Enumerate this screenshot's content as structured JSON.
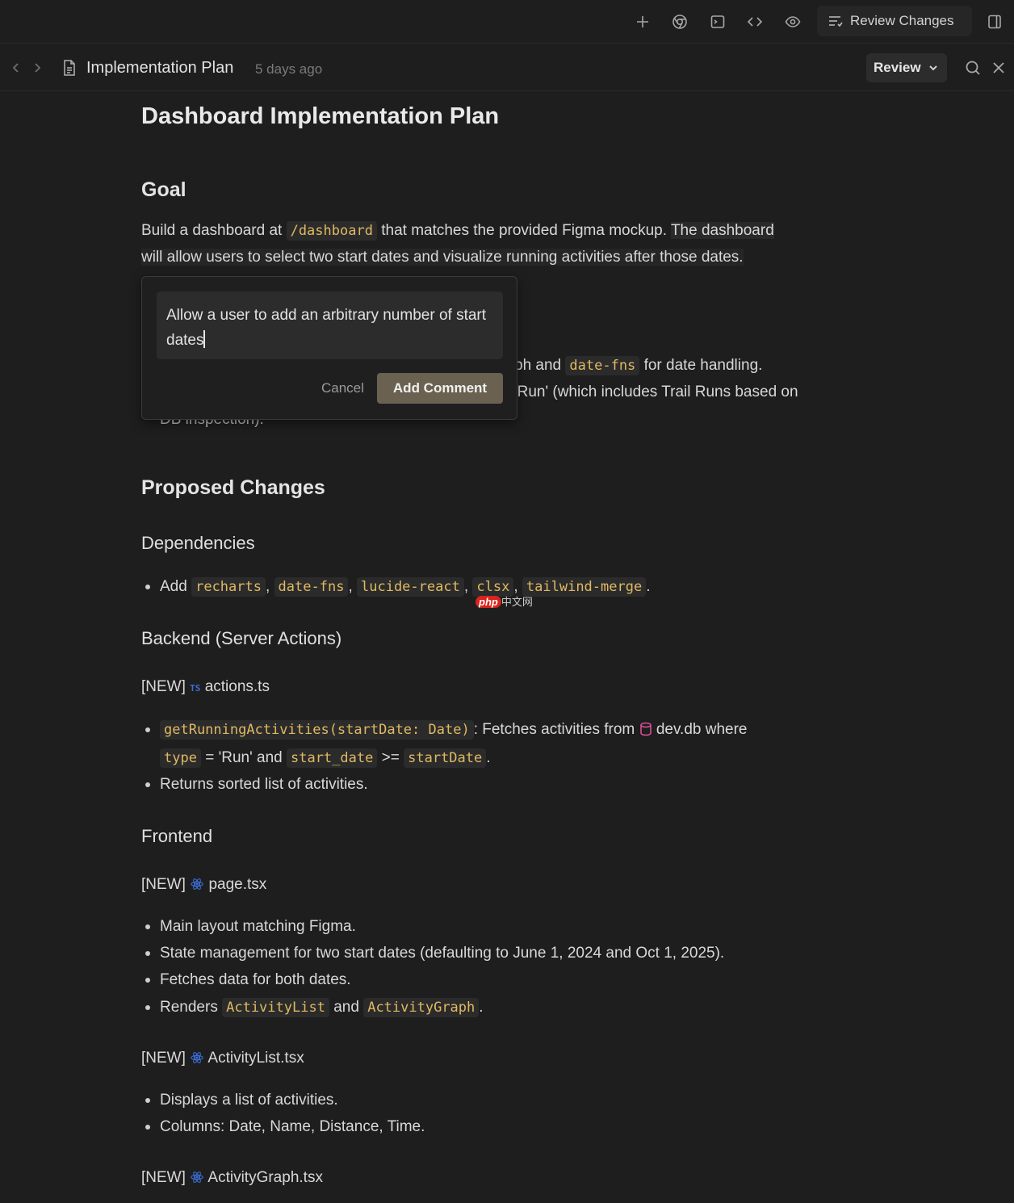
{
  "toolbar": {
    "icons": [
      "plus-icon",
      "chrome-icon",
      "terminal-icon",
      "code-icon",
      "eye-icon",
      "split-panel-icon"
    ],
    "review_changes_label": "Review Changes"
  },
  "doc_header": {
    "title": "Implementation Plan",
    "timestamp": "5 days ago",
    "review_label": "Review"
  },
  "document": {
    "title": "Dashboard Implementation Plan",
    "goal_heading": "Goal",
    "goal_p1_a": "Build a dashboard at",
    "goal_p1_code": "/dashboard",
    "goal_p1_b": "that matches the provided Figma mockup.",
    "goal_p1_c": "The dashboard",
    "goal_p2": "will allow users to select two start dates and visualize running activities after those dates.",
    "hidden_line1_a": "ph and",
    "hidden_line1_code": "date-fns",
    "hidden_line1_b": "for date handling.",
    "hidden_line2": "'Run' (which includes Trail Runs based on",
    "hidden_line3": "DB inspection).",
    "proposed_heading": "Proposed Changes",
    "deps_heading": "Dependencies",
    "deps_add": "Add",
    "deps": [
      "recharts",
      "date-fns",
      "lucide-react",
      "clsx",
      "tailwind-merge"
    ],
    "backend_heading": "Backend (Server Actions)",
    "new_tag": "[NEW]",
    "actions_file": "actions.ts",
    "ts_badge": "TS",
    "backend_b1_code": "getRunningActivities(startDate: Date)",
    "backend_b1_text": ": Fetches activities from",
    "db_file": "dev.db",
    "backend_b1_where": "where",
    "backend_b1_code2": "type",
    "backend_b1_eq": "= 'Run' and",
    "backend_b1_code3": "start_date",
    "backend_b1_gte": ">=",
    "backend_b1_code4": "startDate",
    "backend_b2": "Returns sorted list of activities.",
    "frontend_heading": "Frontend",
    "page_file": "page.tsx",
    "page_bullets": [
      "Main layout matching Figma.",
      "State management for two start dates (defaulting to June 1, 2024 and Oct 1, 2025).",
      "Fetches data for both dates."
    ],
    "renders_a": "Renders",
    "renders_code1": "ActivityList",
    "renders_and": "and",
    "renders_code2": "ActivityGraph",
    "list_file": "ActivityList.tsx",
    "list_bullets": [
      "Displays a list of activities.",
      "Columns: Date, Name, Distance, Time."
    ],
    "graph_file": "ActivityGraph.tsx"
  },
  "comment": {
    "text": "Allow a user to add an arbitrary number of start dates",
    "cancel_label": "Cancel",
    "submit_label": "Add Comment"
  },
  "watermark": {
    "badge": "php",
    "text": "中文网"
  }
}
